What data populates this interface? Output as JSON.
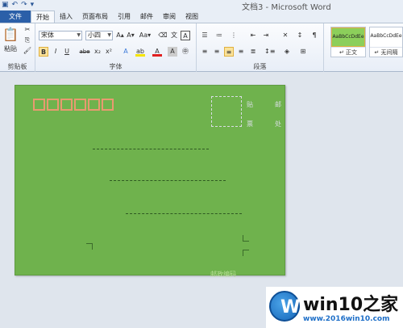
{
  "window": {
    "title": "文档3 - Microsoft Word"
  },
  "quick_access": {
    "save_icon": "save-icon",
    "undo_icon": "undo-icon",
    "redo_icon": "redo-icon"
  },
  "tabs": [
    {
      "label": "文件"
    },
    {
      "label": "开始"
    },
    {
      "label": "插入"
    },
    {
      "label": "页面布局"
    },
    {
      "label": "引用"
    },
    {
      "label": "邮件"
    },
    {
      "label": "审阅"
    },
    {
      "label": "视图"
    }
  ],
  "clipboard": {
    "paste_label": "粘贴",
    "group_label": "剪贴板"
  },
  "font": {
    "name": "宋体",
    "size": "小四",
    "group_label": "字体",
    "bold": "B",
    "italic": "I",
    "underline": "U",
    "strike": "abe",
    "subscript": "x₂",
    "superscript": "x²"
  },
  "paragraph": {
    "group_label": "段落"
  },
  "styles": [
    {
      "sample": "AaBbCcDdEe",
      "name": "↵ 正文"
    },
    {
      "sample": "AaBbCcDdEe",
      "name": "↵ 无间隔"
    }
  ],
  "envelope": {
    "stamp_labels": [
      "贴",
      "邮",
      "票",
      "处"
    ],
    "postcode_label": "邮政编码",
    "zip_boxes": 6
  },
  "watermark": {
    "title": "win10之家",
    "url": "www.2016win10.com"
  },
  "colors": {
    "page": "#6fb24d",
    "file_tab": "#2b5fa8",
    "zip_border": "#e89a70"
  }
}
